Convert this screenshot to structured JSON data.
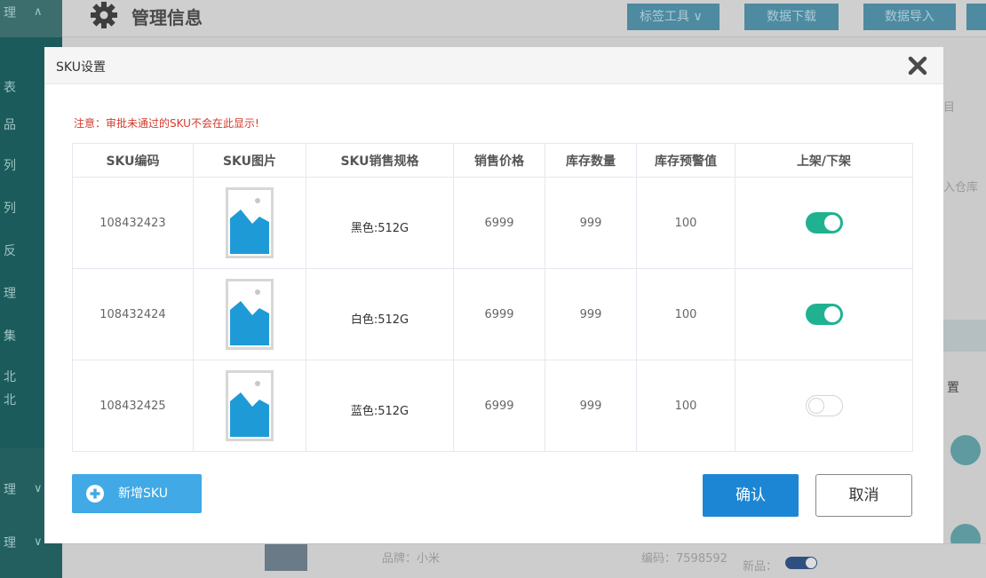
{
  "background": {
    "page_title": "管理信息",
    "buttons": {
      "tag_tool": "标签工具 ∨",
      "data_download": "数据下载",
      "data_import": "数据导入"
    },
    "sidebar_glyphs": [
      "理",
      "表",
      "品",
      "列",
      "列",
      "反",
      "理",
      "集",
      "北",
      "北",
      "理",
      "理"
    ],
    "right_fragments": {
      "r1": "目",
      "r2": "入仓库",
      "r3": "置"
    },
    "bottom_row": {
      "brand": "品牌：小米",
      "code": "编码：7598592",
      "new_label": "新品："
    }
  },
  "modal": {
    "title": "SKU设置",
    "notice": "注意：审批未通过的SKU不会在此显示!",
    "columns": [
      "SKU编码",
      "SKU图片",
      "SKU销售规格",
      "销售价格",
      "库存数量",
      "库存预警值",
      "上架/下架"
    ],
    "rows": [
      {
        "code": "108432423",
        "spec": "黑色:512G",
        "price": "6999",
        "stock": "999",
        "warning": "100",
        "on_shelf": true
      },
      {
        "code": "108432424",
        "spec": "白色:512G",
        "price": "6999",
        "stock": "999",
        "warning": "100",
        "on_shelf": true
      },
      {
        "code": "108432425",
        "spec": "蓝色:512G",
        "price": "6999",
        "stock": "999",
        "warning": "100",
        "on_shelf": false
      }
    ],
    "add_button": "新增SKU",
    "confirm_button": "确认",
    "cancel_button": "取消"
  },
  "icons": {
    "close": "close-icon",
    "plus": "plus-circle-icon",
    "image_placeholder": "image-placeholder-icon",
    "gear": "gear-icon"
  },
  "colors": {
    "toggle_on": "#20b290",
    "primary": "#1c86d4",
    "add_button": "#40a9e6",
    "notice": "#d23a2e",
    "image_placeholder": "#1e9bd7"
  }
}
